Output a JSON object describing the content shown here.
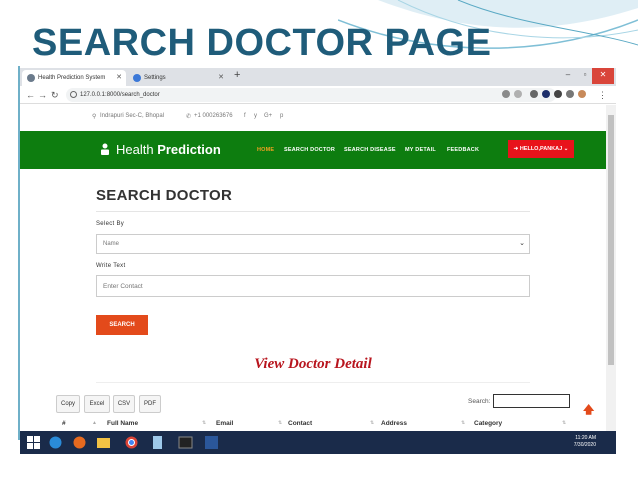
{
  "slide": {
    "title": "SEARCH DOCTOR PAGE"
  },
  "browser": {
    "tabs": [
      {
        "label": "Health Prediction System",
        "active": true
      },
      {
        "label": "Settings",
        "active": false
      }
    ],
    "url": "127.0.0.1:8000/search_doctor"
  },
  "site": {
    "topbar": {
      "address": "Indrapuri Sec-C, Bhopal",
      "phone": "+1 000263676"
    },
    "brand": {
      "light": "Health ",
      "bold": "Prediction"
    },
    "menu": [
      "HOME",
      "SEARCH DOCTOR",
      "SEARCH DISEASE",
      "MY DETAIL",
      "FEEDBACK"
    ],
    "user_button": "HELLO,PANKAJ"
  },
  "form": {
    "heading": "SEARCH DOCTOR",
    "select_label": "Select By",
    "select_value": "Name",
    "text_label": "Write Text",
    "text_placeholder": "Enter Contact",
    "submit_label": "SEARCH"
  },
  "results": {
    "title": "View Doctor Detail",
    "export_buttons": [
      "Copy",
      "Excel",
      "CSV",
      "PDF"
    ],
    "search_label": "Search:",
    "columns": [
      "#",
      "Full Name",
      "Email",
      "Contact",
      "Address",
      "Category"
    ]
  },
  "taskbar": {
    "time": "11:20 AM",
    "date": "7/30/2020"
  },
  "colors": {
    "navbar": "#0d7d0f",
    "accent": "#e34a1b",
    "user_button": "#e8131b",
    "title": "#1f5c7a"
  }
}
